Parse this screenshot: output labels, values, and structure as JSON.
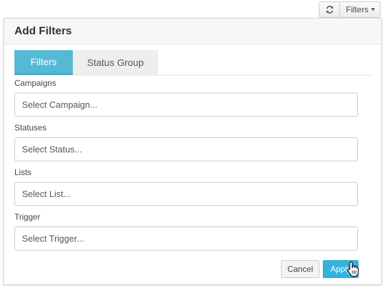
{
  "toolbar": {
    "refresh_icon": "refresh-icon",
    "filters_label": "Filters"
  },
  "panel": {
    "title": "Add Filters",
    "tabs": [
      {
        "label": "Filters",
        "active": true
      },
      {
        "label": "Status Group",
        "active": false
      }
    ],
    "fields": [
      {
        "label": "Campaigns",
        "placeholder": "Select Campaign..."
      },
      {
        "label": "Statuses",
        "placeholder": "Select Status..."
      },
      {
        "label": "Lists",
        "placeholder": "Select List..."
      },
      {
        "label": "Trigger",
        "placeholder": "Select Trigger..."
      }
    ],
    "cancel_label": "Cancel",
    "apply_label": "Apply"
  },
  "colors": {
    "accent": "#55b9d6",
    "apply": "#36b2dc"
  }
}
